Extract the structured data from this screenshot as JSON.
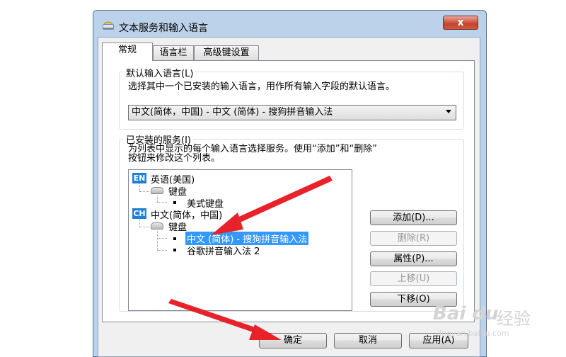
{
  "window": {
    "title": "文本服务和输入语言",
    "close_glyph": "x"
  },
  "tabs": [
    {
      "label": "常规",
      "active": true
    },
    {
      "label": "语言栏",
      "active": false
    },
    {
      "label": "高级键设置",
      "active": false
    }
  ],
  "default_language": {
    "legend": "默认输入语言(L)",
    "description": "选择其中一个已安装的输入语言，用作所有输入字段的默认语言。",
    "selected": "中文(简体，中国) - 中文 (简体) - 搜狗拼音输入法"
  },
  "installed_services": {
    "legend": "已安装的服务(I)",
    "description_line1": "为列表中显示的每个输入语言选择服务。使用“添加”和“删除”",
    "description_line2": "按钮来修改这个列表。",
    "tree": [
      {
        "badge": "EN",
        "label": "英语(美国)",
        "badge_color": "#1f7fd6"
      },
      {
        "category": "键盘"
      },
      {
        "item": "美式键盘"
      },
      {
        "badge": "CH",
        "label": "中文(简体，中国)",
        "badge_color": "#1f7fd6"
      },
      {
        "category": "键盘"
      },
      {
        "item": "中文 (简体) - 搜狗拼音输入法",
        "selected": true
      },
      {
        "item": "谷歌拼音输入法 2"
      }
    ]
  },
  "side_buttons": {
    "add": "添加(D)...",
    "remove": "删除(R)",
    "properties": "属性(P)...",
    "move_up": "上移(U)",
    "move_down": "下移(O)"
  },
  "footer_buttons": {
    "ok": "确定",
    "cancel": "取消",
    "apply": "应用(A)"
  },
  "watermark": {
    "brand": "Bai du",
    "text": "经验",
    "url": "jingyan.baidu.com"
  },
  "colors": {
    "selection": "#3399ff",
    "badge": "#1f7fd6",
    "annotation_arrow": "#e8222b"
  }
}
